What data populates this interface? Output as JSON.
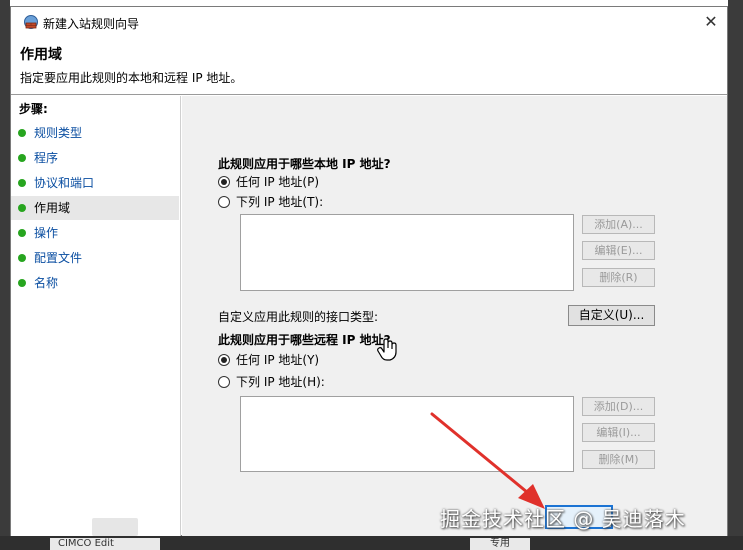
{
  "window": {
    "title": "新建入站规则向导",
    "close_glyph": "✕"
  },
  "header": {
    "title": "作用域",
    "description": "指定要应用此规则的本地和远程 IP 地址。"
  },
  "sidebar": {
    "steps_label": "步骤:",
    "items": [
      {
        "label": "规则类型"
      },
      {
        "label": "程序"
      },
      {
        "label": "协议和端口"
      },
      {
        "label": "作用域"
      },
      {
        "label": "操作"
      },
      {
        "label": "配置文件"
      },
      {
        "label": "名称"
      }
    ],
    "active_index": 3
  },
  "local": {
    "question": "此规则应用于哪些本地 IP 地址?",
    "option_any": "任何 IP 地址(P)",
    "option_list": "下列 IP 地址(T):",
    "selected": "any",
    "add_label": "添加(A)...",
    "edit_label": "编辑(E)...",
    "remove_label": "删除(R)"
  },
  "interface": {
    "label": "自定义应用此规则的接口类型:",
    "button_label": "自定义(U)..."
  },
  "remote": {
    "question": "此规则应用于哪些远程 IP 地址?",
    "option_any": "任何 IP 地址(Y)",
    "option_list": "下列 IP 地址(H):",
    "selected": "any",
    "add_label": "添加(D)...",
    "edit_label": "编辑(I)...",
    "remove_label": "删除(M)"
  },
  "watermark": "掘金技术社区 @ 吴迪落木",
  "background_strip": {
    "left_text": "CIMCO Edit",
    "right_text": "专用"
  },
  "colors": {
    "step_dot": "#27a51f",
    "step_link": "#0a4ea1",
    "arrow": "#e0312b",
    "focus_button": "#1b73d3"
  }
}
